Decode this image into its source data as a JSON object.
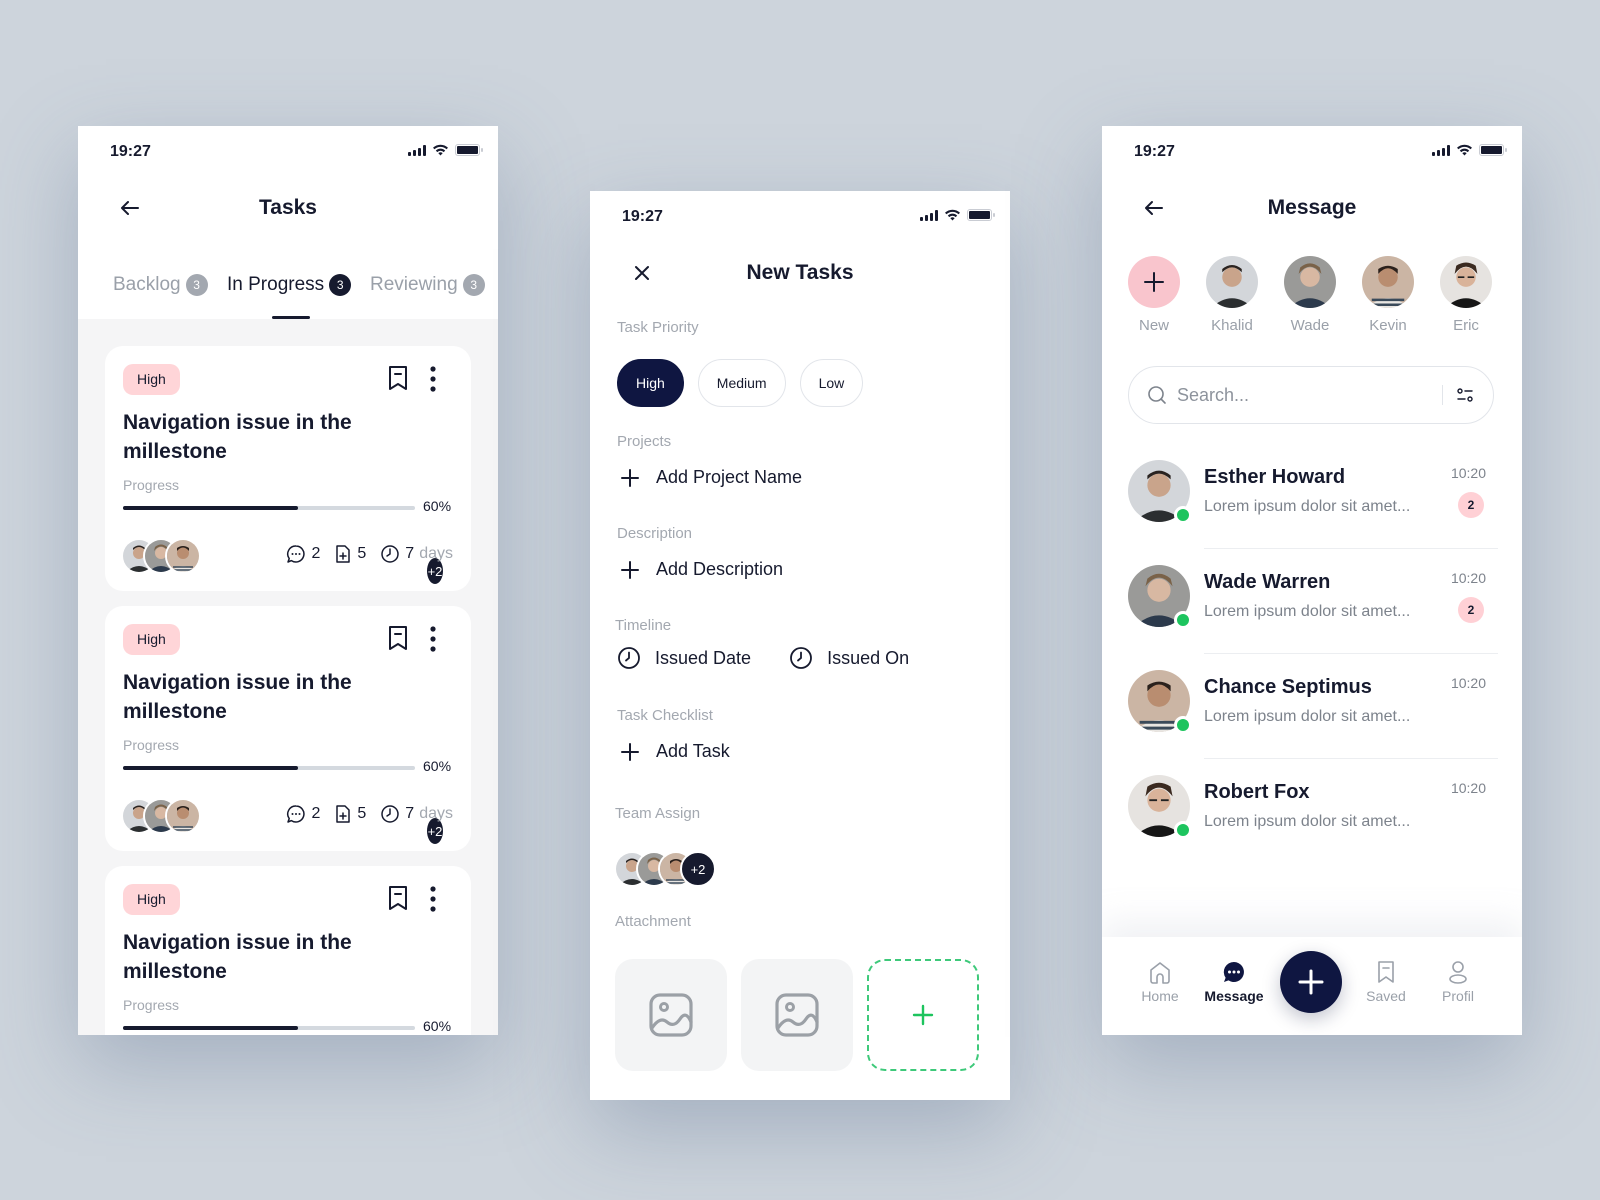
{
  "status_bar": {
    "time": "19:27"
  },
  "tasks_screen": {
    "title": "Tasks",
    "tabs": [
      {
        "label": "Backlog",
        "count": "3"
      },
      {
        "label": "In Progress",
        "count": "3",
        "active": true
      },
      {
        "label": "Reviewing",
        "count": "3"
      }
    ],
    "cards": [
      {
        "priority": "High",
        "title": "Navigation issue in the millestone",
        "progress_label": "Progress",
        "progress_pct": "60%",
        "progress_value": 0.6,
        "extra_members": "+2",
        "comments": "2",
        "files": "5",
        "days_num": "7",
        "days_unit": "days"
      },
      {
        "priority": "High",
        "title": "Navigation issue in the millestone",
        "progress_label": "Progress",
        "progress_pct": "60%",
        "progress_value": 0.6,
        "extra_members": "+2",
        "comments": "2",
        "files": "5",
        "days_num": "7",
        "days_unit": "days"
      },
      {
        "priority": "High",
        "title": "Navigation issue in the millestone",
        "progress_label": "Progress",
        "progress_pct": "60%",
        "progress_value": 0.6
      }
    ]
  },
  "new_task_screen": {
    "title": "New Tasks",
    "priority_label": "Task Priority",
    "priorities": [
      "High",
      "Medium",
      "Low"
    ],
    "selected_priority": "High",
    "projects_label": "Projects",
    "add_project": "Add Project Name",
    "description_label": "Description",
    "add_description": "Add Description",
    "timeline_label": "Timeline",
    "issued_date": "Issued Date",
    "issued_on": "Issued On",
    "checklist_label": "Task Checklist",
    "add_task": "Add Task",
    "team_label": "Team Assign",
    "team_extra": "+2",
    "attachment_label": "Attachment"
  },
  "message_screen": {
    "title": "Message",
    "stories": [
      {
        "name": "New"
      },
      {
        "name": "Khalid"
      },
      {
        "name": "Wade"
      },
      {
        "name": "Kevin"
      },
      {
        "name": "Eric"
      }
    ],
    "search_placeholder": "Search...",
    "chats": [
      {
        "name": "Esther Howard",
        "message": "Lorem ipsum dolor sit amet...",
        "time": "10:20",
        "unread": "2"
      },
      {
        "name": "Wade Warren",
        "message": "Lorem ipsum dolor sit amet...",
        "time": "10:20",
        "unread": "2"
      },
      {
        "name": "Chance Septimus",
        "message": "Lorem ipsum dolor sit amet...",
        "time": "10:20"
      },
      {
        "name": "Robert Fox",
        "message": "Lorem ipsum dolor sit amet...",
        "time": "10:20"
      }
    ],
    "nav": [
      {
        "label": "Home",
        "icon": "home-icon"
      },
      {
        "label": "Message",
        "icon": "chat-icon",
        "active": true
      },
      {
        "label": "Saved",
        "icon": "bookmark-icon"
      },
      {
        "label": "Profil",
        "icon": "user-icon"
      }
    ]
  },
  "colors": {
    "primary": "#0f1641",
    "high_badge": "#ffd5d8",
    "online": "#1dc45e",
    "attach_add": "#3ec97a",
    "background": "#cdd4dc"
  }
}
